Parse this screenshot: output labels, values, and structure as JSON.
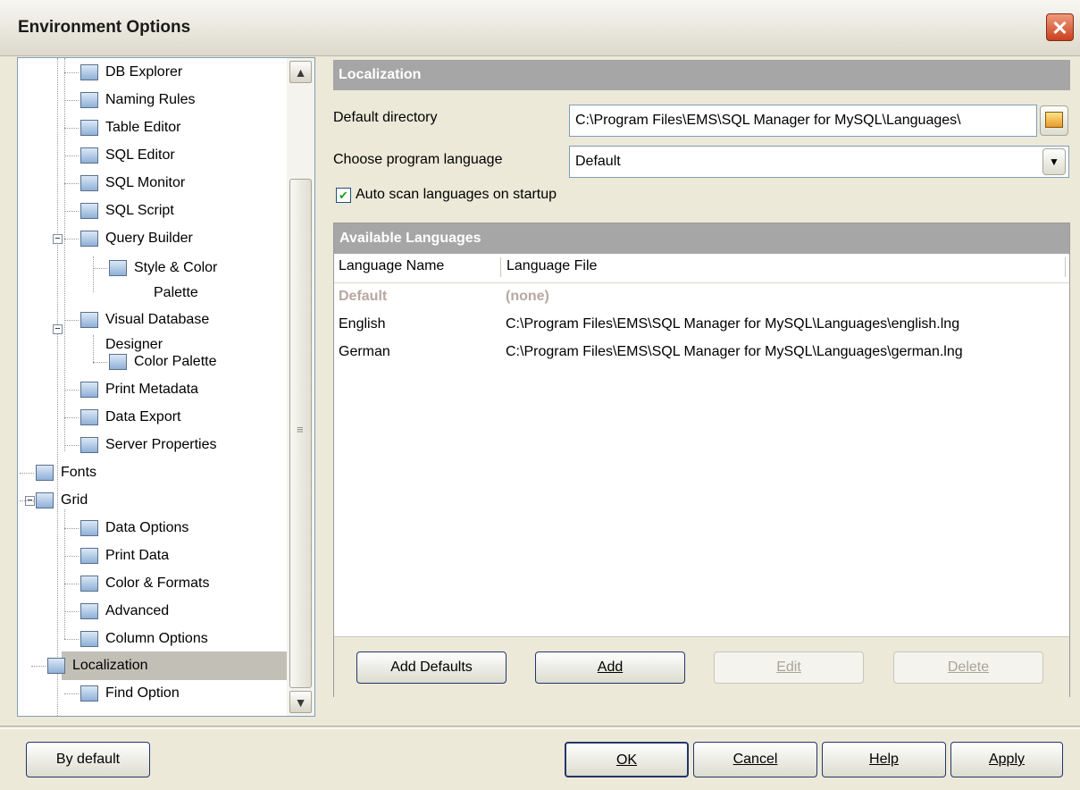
{
  "window": {
    "title": "Environment Options",
    "close_glyph": "✕"
  },
  "tree": {
    "items": [
      {
        "label": "DB Explorer",
        "icon": "db-explorer-icon"
      },
      {
        "label": "Naming Rules",
        "icon": "naming-rules-icon"
      },
      {
        "label": "Table Editor",
        "icon": "table-editor-icon"
      },
      {
        "label": "SQL Editor",
        "icon": "sql-editor-icon"
      },
      {
        "label": "SQL Monitor",
        "icon": "sql-monitor-icon"
      },
      {
        "label": "SQL Script",
        "icon": "sql-script-icon"
      },
      {
        "label": "Query Builder",
        "icon": "query-builder-icon"
      },
      {
        "label": "Style & Color",
        "label2": "Palette",
        "icon": "palette-icon"
      },
      {
        "label": "Visual Database",
        "label2": "Designer",
        "icon": "visual-designer-icon"
      },
      {
        "label": "Color Palette",
        "icon": "color-palette-icon"
      },
      {
        "label": "Print Metadata",
        "icon": "printer-icon"
      },
      {
        "label": "Data Export",
        "icon": "data-export-icon"
      },
      {
        "label": "Server Properties",
        "icon": "server-properties-icon"
      },
      {
        "label": "Fonts",
        "icon": "fonts-icon"
      },
      {
        "label": "Grid",
        "icon": "grid-icon"
      },
      {
        "label": "Data Options",
        "icon": "data-options-icon"
      },
      {
        "label": "Print Data",
        "icon": "printer-icon"
      },
      {
        "label": "Color & Formats",
        "icon": "color-formats-icon"
      },
      {
        "label": "Advanced",
        "icon": "advanced-icon"
      },
      {
        "label": "Column Options",
        "icon": "column-options-icon"
      },
      {
        "label": "Localization",
        "icon": "localization-icon"
      },
      {
        "label": "Find Option",
        "icon": "find-option-icon"
      }
    ],
    "expander_minus": "−",
    "scroll_up": "▲",
    "scroll_down": "▼",
    "grip": "≡"
  },
  "localization": {
    "header": "Localization",
    "default_dir_label": "Default directory",
    "default_dir_value": "C:\\Program Files\\EMS\\SQL Manager for MySQL\\Languages\\",
    "language_label": "Choose program language",
    "language_value": "Default",
    "auto_scan_label": "Auto scan languages on startup",
    "auto_scan_checked": true,
    "check_glyph": "✔",
    "dropdown_glyph": "▼"
  },
  "languages": {
    "header": "Available Languages",
    "columns": [
      "Language Name",
      "Language File"
    ],
    "rows": [
      {
        "name": "Default",
        "file": "(none)"
      },
      {
        "name": "English",
        "file": "C:\\Program Files\\EMS\\SQL Manager for MySQL\\Languages\\english.lng"
      },
      {
        "name": "German",
        "file": "C:\\Program Files\\EMS\\SQL Manager for MySQL\\Languages\\german.lng"
      }
    ],
    "buttons": {
      "add_defaults": "Add Defaults",
      "add": "Add",
      "edit": "Edit",
      "delete": "Delete"
    }
  },
  "footer": {
    "by_default": "By default",
    "ok": "OK",
    "cancel": "Cancel",
    "help": "Help",
    "apply": "Apply"
  }
}
